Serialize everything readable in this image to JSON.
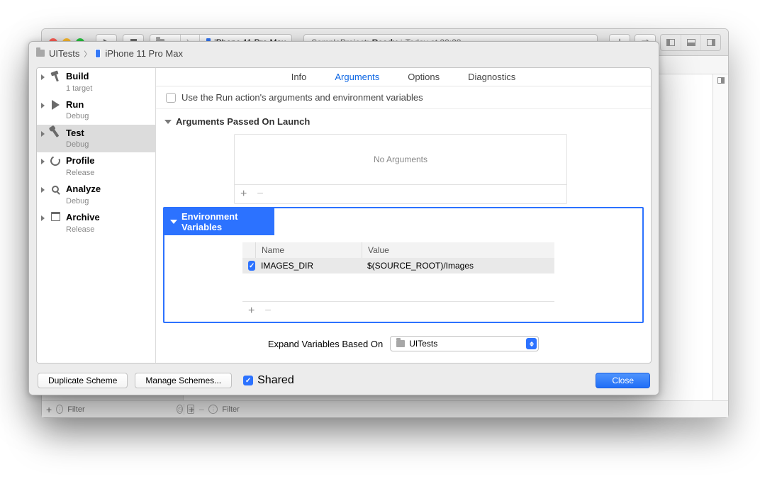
{
  "toolbar": {
    "scheme_path": "...",
    "device": "iPhone 11 Pro Max",
    "status_project": "SampleProject:",
    "status_state": "Ready",
    "status_sep": "|",
    "status_time": "Today at 20:28"
  },
  "bottom": {
    "filter_placeholder": "Filter"
  },
  "sheet": {
    "breadcrumb_scheme": "UITests",
    "breadcrumb_device": "iPhone 11 Pro Max",
    "actions": [
      {
        "name": "Build",
        "sub": "1 target"
      },
      {
        "name": "Run",
        "sub": "Debug"
      },
      {
        "name": "Test",
        "sub": "Debug"
      },
      {
        "name": "Profile",
        "sub": "Release"
      },
      {
        "name": "Analyze",
        "sub": "Debug"
      },
      {
        "name": "Archive",
        "sub": "Release"
      }
    ],
    "tabs": {
      "info": "Info",
      "arguments": "Arguments",
      "options": "Options",
      "diagnostics": "Diagnostics"
    },
    "use_run_args": "Use the Run action's arguments and environment variables",
    "args_section": "Arguments Passed On Launch",
    "args_empty": "No Arguments",
    "env_section": "Environment Variables",
    "env_headers": {
      "name": "Name",
      "value": "Value"
    },
    "env_vars": [
      {
        "enabled": true,
        "name": "IMAGES_DIR",
        "value": "$(SOURCE_ROOT)/Images"
      }
    ],
    "expand_label": "Expand Variables Based On",
    "expand_value": "UITests",
    "footer": {
      "duplicate": "Duplicate Scheme",
      "manage": "Manage Schemes...",
      "shared": "Shared",
      "close": "Close"
    }
  }
}
